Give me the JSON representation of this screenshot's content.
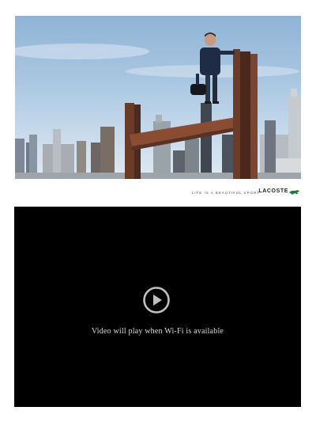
{
  "ad": {
    "image_alt": "man-on-steel-beam-city-skyline",
    "tagline": "LIFE IS A BEAUTIFUL SPORT",
    "brand": "LACOSTE",
    "logo_icon": "crocodile-logo-icon",
    "logo_color": "#1f7a3a"
  },
  "video": {
    "play_icon": "play-icon",
    "message": "Video will play when Wi-Fi is available",
    "background": "#000000",
    "icon_color": "#bfbfbf"
  }
}
